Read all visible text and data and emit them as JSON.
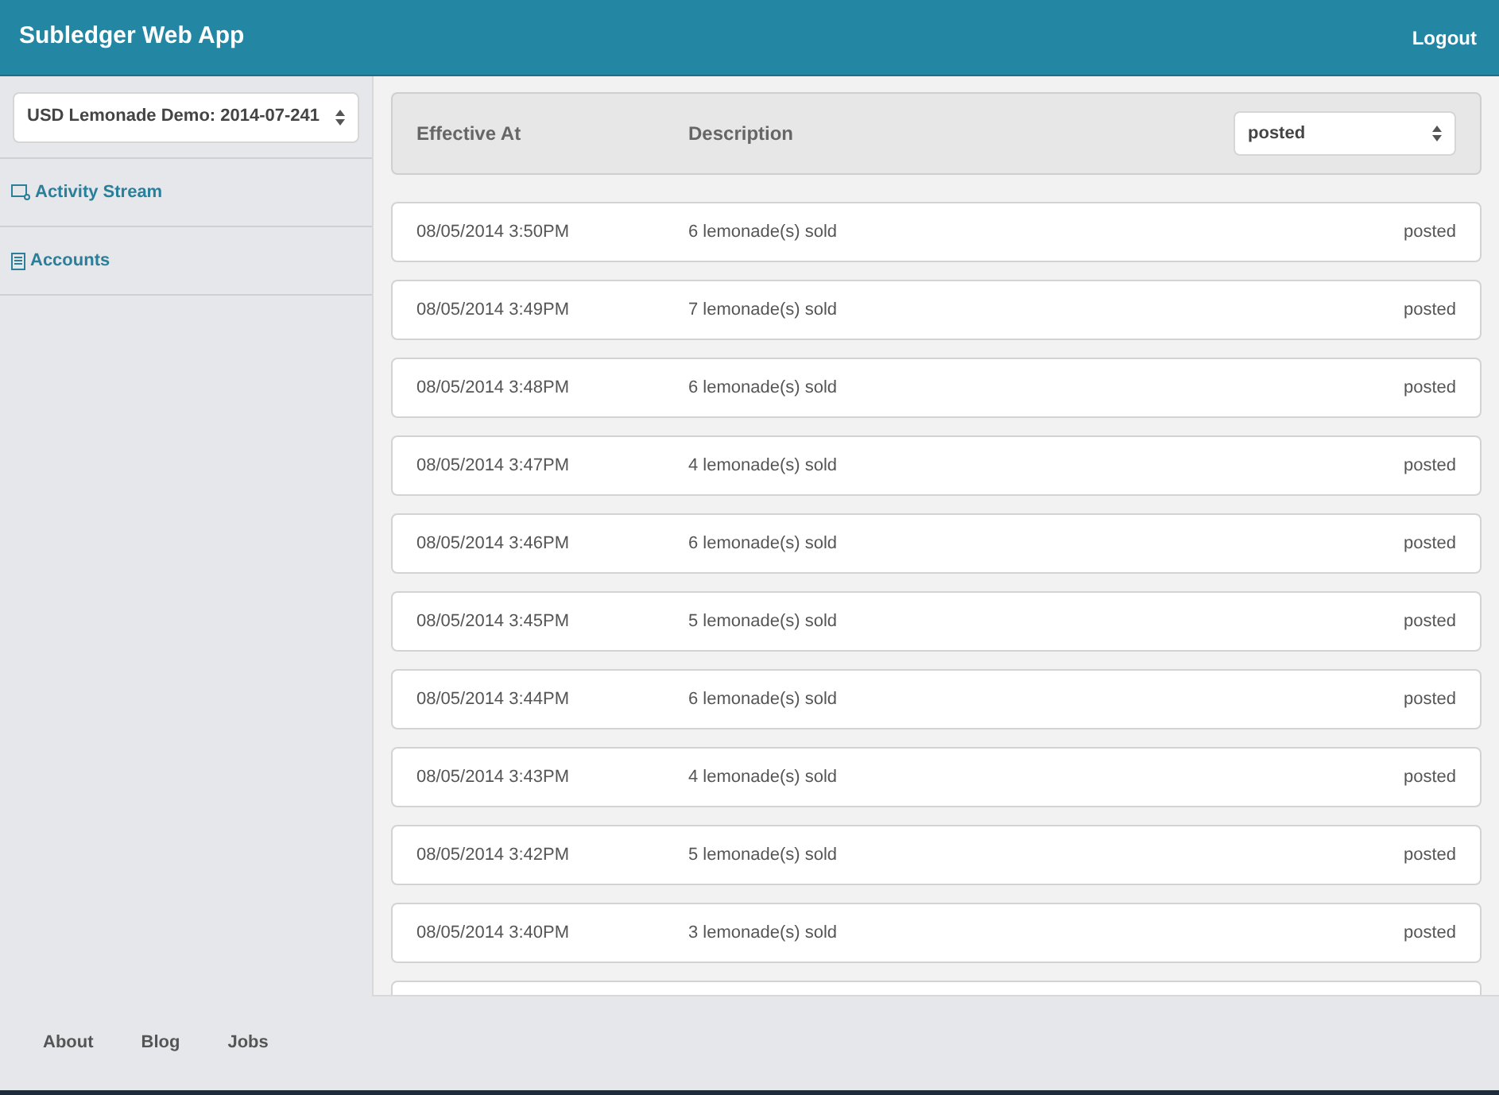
{
  "header": {
    "title": "Subledger Web App",
    "logout": "Logout"
  },
  "sidebar": {
    "book_select": {
      "value": "USD Lemonade Demo: 2014-07-241"
    },
    "items": [
      {
        "label": "Activity Stream"
      },
      {
        "label": "Accounts"
      }
    ]
  },
  "table": {
    "columns": [
      "Effective At",
      "Description"
    ],
    "filter": {
      "value": "posted"
    },
    "rows": [
      {
        "effective_at": "08/05/2014 3:50PM",
        "description": "6 lemonade(s) sold",
        "status": "posted"
      },
      {
        "effective_at": "08/05/2014 3:49PM",
        "description": "7 lemonade(s) sold",
        "status": "posted"
      },
      {
        "effective_at": "08/05/2014 3:48PM",
        "description": "6 lemonade(s) sold",
        "status": "posted"
      },
      {
        "effective_at": "08/05/2014 3:47PM",
        "description": "4 lemonade(s) sold",
        "status": "posted"
      },
      {
        "effective_at": "08/05/2014 3:46PM",
        "description": "6 lemonade(s) sold",
        "status": "posted"
      },
      {
        "effective_at": "08/05/2014 3:45PM",
        "description": "5 lemonade(s) sold",
        "status": "posted"
      },
      {
        "effective_at": "08/05/2014 3:44PM",
        "description": "6 lemonade(s) sold",
        "status": "posted"
      },
      {
        "effective_at": "08/05/2014 3:43PM",
        "description": "4 lemonade(s) sold",
        "status": "posted"
      },
      {
        "effective_at": "08/05/2014 3:42PM",
        "description": "5 lemonade(s) sold",
        "status": "posted"
      },
      {
        "effective_at": "08/05/2014 3:40PM",
        "description": "3 lemonade(s) sold",
        "status": "posted"
      }
    ]
  },
  "footer": {
    "links": [
      "About",
      "Blog",
      "Jobs"
    ]
  }
}
